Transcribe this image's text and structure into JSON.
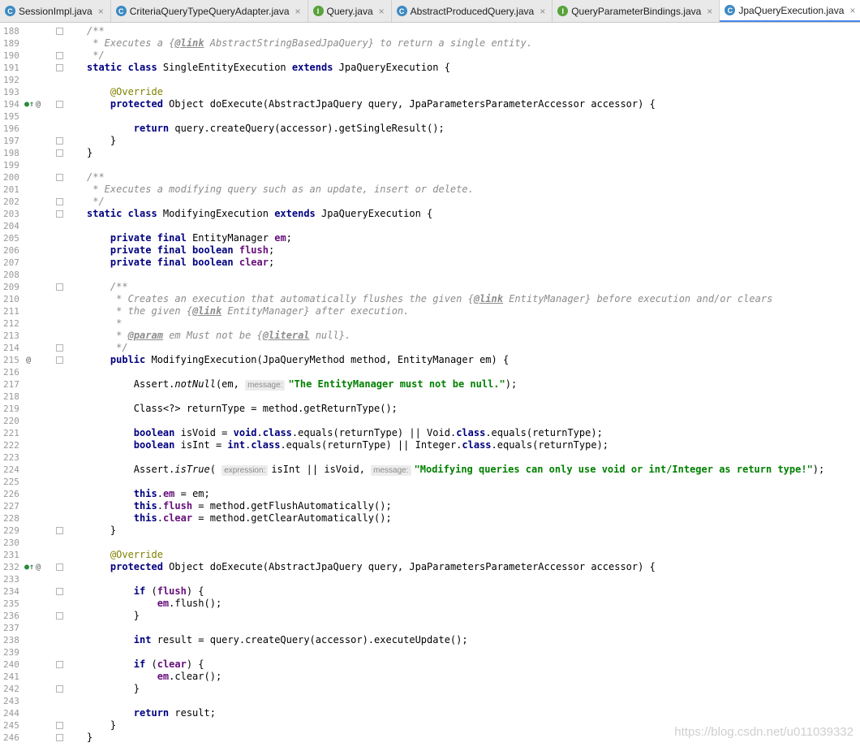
{
  "tabs": [
    {
      "icon": "C",
      "label": "SessionImpl.java",
      "close": "×"
    },
    {
      "icon": "C",
      "label": "CriteriaQueryTypeQueryAdapter.java",
      "close": "×"
    },
    {
      "icon": "I",
      "label": "Query.java",
      "close": "×"
    },
    {
      "icon": "C",
      "label": "AbstractProducedQuery.java",
      "close": "×"
    },
    {
      "icon": "I",
      "label": "QueryParameterBindings.java",
      "close": "×"
    },
    {
      "icon": "C",
      "label": "JpaQueryExecution.java",
      "close": "×"
    }
  ],
  "active_tab": 5,
  "editor": {
    "lines": [
      {
        "n": "188",
        "fold": true,
        "t": [
          {
            "c": "cm",
            "v": "/**"
          }
        ]
      },
      {
        "n": "189",
        "t": [
          {
            "c": "cm",
            "v": " * Executes a {"
          },
          {
            "c": "tag",
            "v": "@link"
          },
          {
            "c": "cm",
            "v": " AbstractStringBasedJpaQuery} to return a single entity."
          }
        ]
      },
      {
        "n": "190",
        "fold": true,
        "t": [
          {
            "c": "cm",
            "v": " */"
          }
        ]
      },
      {
        "n": "191",
        "fold": true,
        "t": [
          {
            "c": "kw",
            "v": "static class "
          },
          {
            "v": "SingleEntityExecution "
          },
          {
            "c": "kw",
            "v": "extends "
          },
          {
            "v": "JpaQueryExecution {"
          }
        ]
      },
      {
        "n": "192",
        "t": []
      },
      {
        "n": "193",
        "t": [
          {
            "v": "    "
          },
          {
            "c": "ann",
            "v": "@Override"
          }
        ]
      },
      {
        "n": "194",
        "gutter": [
          "override",
          "at"
        ],
        "fold": true,
        "t": [
          {
            "v": "    "
          },
          {
            "c": "kw",
            "v": "protected "
          },
          {
            "v": "Object doExecute(AbstractJpaQuery query, JpaParametersParameterAccessor accessor) {"
          }
        ]
      },
      {
        "n": "195",
        "t": []
      },
      {
        "n": "196",
        "t": [
          {
            "v": "        "
          },
          {
            "c": "kw",
            "v": "return "
          },
          {
            "v": "query.createQuery(accessor).getSingleResult();"
          }
        ]
      },
      {
        "n": "197",
        "fold": true,
        "t": [
          {
            "v": "    }"
          }
        ]
      },
      {
        "n": "198",
        "fold": true,
        "t": [
          {
            "v": "}"
          }
        ]
      },
      {
        "n": "199",
        "t": []
      },
      {
        "n": "200",
        "fold": true,
        "t": [
          {
            "c": "cm",
            "v": "/**"
          }
        ]
      },
      {
        "n": "201",
        "t": [
          {
            "c": "cm",
            "v": " * Executes a modifying query such as an update, insert or delete."
          }
        ]
      },
      {
        "n": "202",
        "fold": true,
        "t": [
          {
            "c": "cm",
            "v": " */"
          }
        ]
      },
      {
        "n": "203",
        "fold": true,
        "t": [
          {
            "c": "kw",
            "v": "static class "
          },
          {
            "v": "ModifyingExecution "
          },
          {
            "c": "kw",
            "v": "extends "
          },
          {
            "v": "JpaQueryExecution {"
          }
        ]
      },
      {
        "n": "204",
        "t": []
      },
      {
        "n": "205",
        "t": [
          {
            "v": "    "
          },
          {
            "c": "kw",
            "v": "private final "
          },
          {
            "v": "EntityManager "
          },
          {
            "c": "fld",
            "v": "em"
          },
          {
            "v": ";"
          }
        ]
      },
      {
        "n": "206",
        "t": [
          {
            "v": "    "
          },
          {
            "c": "kw",
            "v": "private final boolean "
          },
          {
            "c": "fld",
            "v": "flush"
          },
          {
            "v": ";"
          }
        ]
      },
      {
        "n": "207",
        "t": [
          {
            "v": "    "
          },
          {
            "c": "kw",
            "v": "private final boolean "
          },
          {
            "c": "fld",
            "v": "clear"
          },
          {
            "v": ";"
          }
        ]
      },
      {
        "n": "208",
        "t": []
      },
      {
        "n": "209",
        "fold": true,
        "t": [
          {
            "v": "    "
          },
          {
            "c": "cm",
            "v": "/**"
          }
        ]
      },
      {
        "n": "210",
        "t": [
          {
            "v": "    "
          },
          {
            "c": "cm",
            "v": " * Creates an execution that automatically flushes the given {"
          },
          {
            "c": "tag",
            "v": "@link"
          },
          {
            "c": "cm",
            "v": " EntityManager} before execution and/or clears"
          }
        ]
      },
      {
        "n": "211",
        "t": [
          {
            "v": "    "
          },
          {
            "c": "cm",
            "v": " * the given {"
          },
          {
            "c": "tag",
            "v": "@link"
          },
          {
            "c": "cm",
            "v": " EntityManager} after execution."
          }
        ]
      },
      {
        "n": "212",
        "t": [
          {
            "v": "    "
          },
          {
            "c": "cm",
            "v": " *"
          }
        ]
      },
      {
        "n": "213",
        "t": [
          {
            "v": "    "
          },
          {
            "c": "cm",
            "v": " * "
          },
          {
            "c": "tag",
            "v": "@param"
          },
          {
            "c": "cm",
            "v": " "
          },
          {
            "c": "cm",
            "v": "em"
          },
          {
            "c": "cm",
            "v": " Must not be {"
          },
          {
            "c": "tag",
            "v": "@literal"
          },
          {
            "c": "cm",
            "v": " null}."
          }
        ]
      },
      {
        "n": "214",
        "fold": true,
        "t": [
          {
            "v": "    "
          },
          {
            "c": "cm",
            "v": " */"
          }
        ]
      },
      {
        "n": "215",
        "gutter": [
          "at"
        ],
        "fold": true,
        "t": [
          {
            "v": "    "
          },
          {
            "c": "kw",
            "v": "public "
          },
          {
            "v": "ModifyingExecution(JpaQueryMethod method, EntityManager em) {"
          }
        ]
      },
      {
        "n": "216",
        "t": []
      },
      {
        "n": "217",
        "t": [
          {
            "v": "        Assert."
          },
          {
            "c": "sm",
            "v": "notNull"
          },
          {
            "v": "(em, "
          },
          {
            "c": "hint",
            "v": "message:"
          },
          {
            "c": "str",
            "v": "\"The EntityManager must not be null.\""
          },
          {
            "v": ");"
          }
        ]
      },
      {
        "n": "218",
        "t": []
      },
      {
        "n": "219",
        "t": [
          {
            "v": "        Class<?> returnType = method.getReturnType();"
          }
        ]
      },
      {
        "n": "220",
        "t": []
      },
      {
        "n": "221",
        "t": [
          {
            "v": "        "
          },
          {
            "c": "kw",
            "v": "boolean "
          },
          {
            "v": "isVoid = "
          },
          {
            "c": "kw",
            "v": "void"
          },
          {
            "v": "."
          },
          {
            "c": "kw",
            "v": "class"
          },
          {
            "v": ".equals(returnType) || Void."
          },
          {
            "c": "kw",
            "v": "class"
          },
          {
            "v": ".equals(returnType);"
          }
        ]
      },
      {
        "n": "222",
        "t": [
          {
            "v": "        "
          },
          {
            "c": "kw",
            "v": "boolean "
          },
          {
            "v": "isInt = "
          },
          {
            "c": "kw",
            "v": "int"
          },
          {
            "v": "."
          },
          {
            "c": "kw",
            "v": "class"
          },
          {
            "v": ".equals(returnType) || Integer."
          },
          {
            "c": "kw",
            "v": "class"
          },
          {
            "v": ".equals(returnType);"
          }
        ]
      },
      {
        "n": "223",
        "t": []
      },
      {
        "n": "224",
        "t": [
          {
            "v": "        Assert."
          },
          {
            "c": "sm",
            "v": "isTrue"
          },
          {
            "v": "( "
          },
          {
            "c": "hint",
            "v": "expression:"
          },
          {
            "v": "isInt || isVoid, "
          },
          {
            "c": "hint",
            "v": "message:"
          },
          {
            "c": "str",
            "v": "\"Modifying queries can only use void or int/Integer as return type!\""
          },
          {
            "v": ");"
          }
        ]
      },
      {
        "n": "225",
        "t": []
      },
      {
        "n": "226",
        "t": [
          {
            "v": "        "
          },
          {
            "c": "kw",
            "v": "this"
          },
          {
            "v": "."
          },
          {
            "c": "fld",
            "v": "em"
          },
          {
            "v": " = em;"
          }
        ]
      },
      {
        "n": "227",
        "t": [
          {
            "v": "        "
          },
          {
            "c": "kw",
            "v": "this"
          },
          {
            "v": "."
          },
          {
            "c": "fld",
            "v": "flush"
          },
          {
            "v": " = method.getFlushAutomatically();"
          }
        ]
      },
      {
        "n": "228",
        "t": [
          {
            "v": "        "
          },
          {
            "c": "kw",
            "v": "this"
          },
          {
            "v": "."
          },
          {
            "c": "fld",
            "v": "clear"
          },
          {
            "v": " = method.getClearAutomatically();"
          }
        ]
      },
      {
        "n": "229",
        "fold": true,
        "t": [
          {
            "v": "    }"
          }
        ]
      },
      {
        "n": "230",
        "t": []
      },
      {
        "n": "231",
        "t": [
          {
            "v": "    "
          },
          {
            "c": "ann",
            "v": "@Override"
          }
        ]
      },
      {
        "n": "232",
        "gutter": [
          "override",
          "at"
        ],
        "fold": true,
        "t": [
          {
            "v": "    "
          },
          {
            "c": "kw",
            "v": "protected "
          },
          {
            "v": "Object doExecute(AbstractJpaQuery query, JpaParametersParameterAccessor accessor) {"
          }
        ]
      },
      {
        "n": "233",
        "t": []
      },
      {
        "n": "234",
        "fold": true,
        "t": [
          {
            "v": "        "
          },
          {
            "c": "kw",
            "v": "if "
          },
          {
            "v": "("
          },
          {
            "c": "fld",
            "v": "flush"
          },
          {
            "v": ") {"
          }
        ]
      },
      {
        "n": "235",
        "t": [
          {
            "v": "            "
          },
          {
            "c": "fld",
            "v": "em"
          },
          {
            "v": ".flush();"
          }
        ]
      },
      {
        "n": "236",
        "fold": true,
        "t": [
          {
            "v": "        }"
          }
        ]
      },
      {
        "n": "237",
        "t": []
      },
      {
        "n": "238",
        "t": [
          {
            "v": "        "
          },
          {
            "c": "kw",
            "v": "int "
          },
          {
            "v": "result = query.createQuery(accessor).executeUpdate();"
          }
        ]
      },
      {
        "n": "239",
        "t": []
      },
      {
        "n": "240",
        "fold": true,
        "t": [
          {
            "v": "        "
          },
          {
            "c": "kw",
            "v": "if "
          },
          {
            "v": "("
          },
          {
            "c": "fld",
            "v": "clear"
          },
          {
            "v": ") {"
          }
        ]
      },
      {
        "n": "241",
        "t": [
          {
            "v": "            "
          },
          {
            "c": "fld",
            "v": "em"
          },
          {
            "v": ".clear();"
          }
        ]
      },
      {
        "n": "242",
        "fold": true,
        "t": [
          {
            "v": "        }"
          }
        ]
      },
      {
        "n": "243",
        "t": []
      },
      {
        "n": "244",
        "t": [
          {
            "v": "        "
          },
          {
            "c": "kw",
            "v": "return "
          },
          {
            "v": "result;"
          }
        ]
      },
      {
        "n": "245",
        "fold": true,
        "t": [
          {
            "v": "    }"
          }
        ]
      },
      {
        "n": "246",
        "fold": true,
        "t": [
          {
            "v": "}"
          }
        ]
      }
    ]
  },
  "gutter_icons": {
    "override": "overridden-method-icon",
    "at": "annotation-icon"
  },
  "gutter_glyphs": {
    "override": "●↑",
    "at": "@"
  },
  "watermark": "https://blog.csdn.net/u011039332",
  "colors": {
    "keyword": "#000080",
    "comment": "#8c8c8c",
    "annotation": "#808000",
    "field": "#660e7a",
    "string": "#008000",
    "active_tab_underline": "#4a86e8"
  }
}
